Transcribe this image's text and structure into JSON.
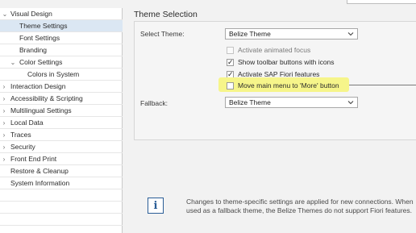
{
  "nav": {
    "items": [
      {
        "label": "Visual Design",
        "chevron": "down",
        "level": 0,
        "selected": false
      },
      {
        "label": "Theme Settings",
        "chevron": "",
        "level": 1,
        "selected": true
      },
      {
        "label": "Font Settings",
        "chevron": "",
        "level": 1,
        "selected": false
      },
      {
        "label": "Branding",
        "chevron": "",
        "level": 1,
        "selected": false
      },
      {
        "label": "Color Settings",
        "chevron": "down",
        "level": 1,
        "selected": false
      },
      {
        "label": "Colors in System",
        "chevron": "",
        "level": 2,
        "selected": false
      },
      {
        "label": "Interaction Design",
        "chevron": "right",
        "level": 0,
        "selected": false
      },
      {
        "label": "Accessibility & Scripting",
        "chevron": "right",
        "level": 0,
        "selected": false
      },
      {
        "label": "Multilingual Settings",
        "chevron": "right",
        "level": 0,
        "selected": false
      },
      {
        "label": "Local Data",
        "chevron": "right",
        "level": 0,
        "selected": false
      },
      {
        "label": "Traces",
        "chevron": "right",
        "level": 0,
        "selected": false
      },
      {
        "label": "Security",
        "chevron": "right",
        "level": 0,
        "selected": false
      },
      {
        "label": "Front End Print",
        "chevron": "right",
        "level": 0,
        "selected": false
      },
      {
        "label": "Restore & Cleanup",
        "chevron": "",
        "level": 0,
        "selected": false
      },
      {
        "label": "System Information",
        "chevron": "",
        "level": 0,
        "selected": false
      }
    ]
  },
  "section": {
    "title": "Theme Selection",
    "select_theme_label": "Select Theme:",
    "select_theme_value": "Belize Theme",
    "fallback_label": "Fallback:",
    "fallback_value": "Belize Theme",
    "options": [
      {
        "label": "Activate animated focus",
        "checked": false,
        "enabled": false
      },
      {
        "label": "Show toolbar buttons with icons",
        "checked": true,
        "enabled": true
      },
      {
        "label": "Activate SAP Fiori features",
        "checked": true,
        "enabled": true
      },
      {
        "label": "Move main menu to 'More' button",
        "checked": false,
        "enabled": true
      }
    ]
  },
  "info": {
    "icon": "info-icon",
    "text": "Changes to theme-specific settings are applied for new connections. When used as a fallback theme, the Belize Themes do not support Fiori features."
  },
  "colors": {
    "selected_row": "#dbe7f3",
    "highlight": "#f6f58a",
    "info_blue": "#2a5d96"
  }
}
